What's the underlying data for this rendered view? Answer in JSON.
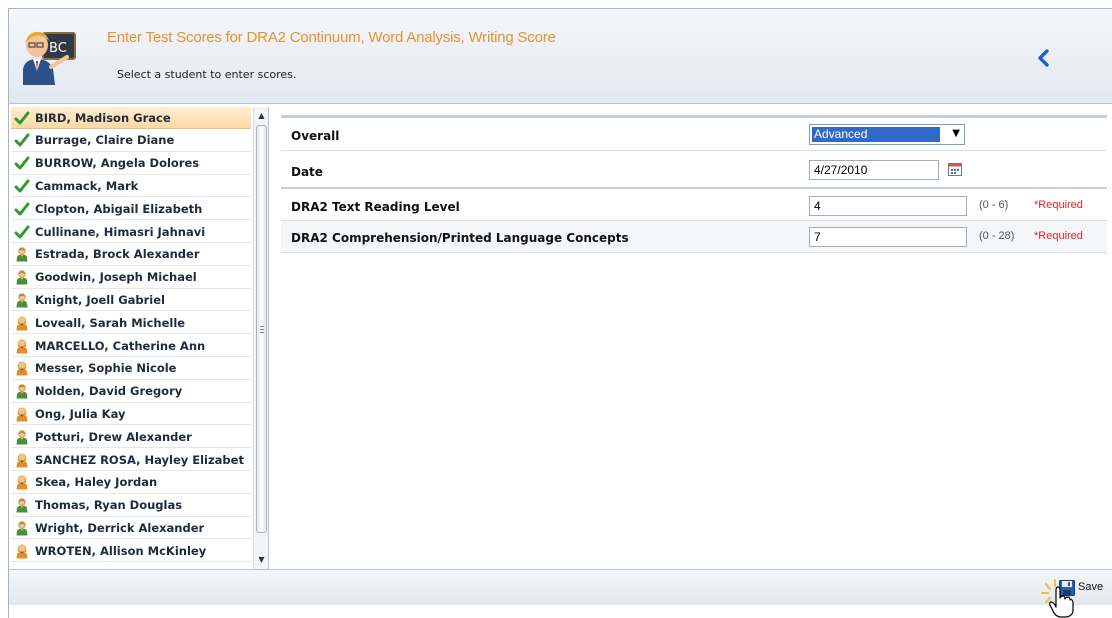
{
  "header": {
    "title": "Enter Test Scores for DRA2 Continuum, Word Analysis, Writing Score",
    "subtitle": "Select a student to enter scores.",
    "icon": "teacher-abc-icon",
    "collapse_icon": "chevron-left-icon"
  },
  "students": [
    {
      "name": "BIRD, Madison Grace",
      "status": "complete",
      "selected": true
    },
    {
      "name": "Burrage, Claire Diane",
      "status": "complete"
    },
    {
      "name": "BURROW, Angela Dolores",
      "status": "complete"
    },
    {
      "name": "Cammack, Mark",
      "status": "complete"
    },
    {
      "name": "Clopton, Abigail Elizabeth",
      "status": "complete"
    },
    {
      "name": "Cullinane, Himasri Jahnavi",
      "status": "complete"
    },
    {
      "name": "Estrada, Brock Alexander",
      "status": "male"
    },
    {
      "name": "Goodwin, Joseph Michael",
      "status": "male"
    },
    {
      "name": "Knight, Joell Gabriel",
      "status": "male"
    },
    {
      "name": "Loveall, Sarah Michelle",
      "status": "female"
    },
    {
      "name": "MARCELLO, Catherine Ann",
      "status": "female"
    },
    {
      "name": "Messer, Sophie Nicole",
      "status": "female"
    },
    {
      "name": "Nolden, David Gregory",
      "status": "male"
    },
    {
      "name": "Ong, Julia Kay",
      "status": "female"
    },
    {
      "name": "Potturi, Drew Alexander",
      "status": "male"
    },
    {
      "name": "SANCHEZ ROSA, Hayley Elizabet",
      "status": "female"
    },
    {
      "name": "Skea, Haley Jordan",
      "status": "female"
    },
    {
      "name": "Thomas, Ryan Douglas",
      "status": "male"
    },
    {
      "name": "Wright, Derrick Alexander",
      "status": "male"
    },
    {
      "name": "WROTEN, Allison McKinley",
      "status": "female"
    }
  ],
  "form": {
    "overall": {
      "label": "Overall",
      "value": "Advanced"
    },
    "date": {
      "label": "Date",
      "value": "4/27/2010",
      "icon": "calendar-icon"
    },
    "text_reading": {
      "label": "DRA2 Text Reading Level",
      "value": "4",
      "range": "(0 - 6)",
      "required": "*Required"
    },
    "comprehension": {
      "label": "DRA2 Comprehension/Printed Language Concepts",
      "value": "7",
      "range": "(0 - 28)",
      "required": "*Required"
    }
  },
  "footer": {
    "save_label": "Save",
    "save_icon": "floppy-disk-icon"
  },
  "colors": {
    "title": "#e8922e",
    "required": "#e8222a",
    "selection": "#316ac5",
    "check": "#2e9a2e"
  }
}
